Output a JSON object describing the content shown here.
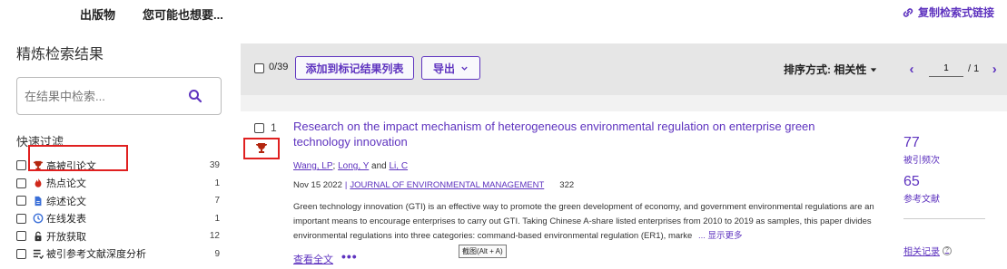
{
  "topnav": {
    "publications": "出版物",
    "you_may_like": "您可能也想要...",
    "copy_link": "复制检索式链接"
  },
  "refine": {
    "title": "精炼检索结果",
    "search_placeholder": "在结果中检索...",
    "quick_filter_title": "快速过滤",
    "filters": [
      {
        "label": "高被引论文",
        "count": "39",
        "icon": "trophy-icon"
      },
      {
        "label": "热点论文",
        "count": "1",
        "icon": "flame-icon"
      },
      {
        "label": "综述论文",
        "count": "7",
        "icon": "document-icon"
      },
      {
        "label": "在线发表",
        "count": "1",
        "icon": "clock-icon"
      },
      {
        "label": "开放获取",
        "count": "12",
        "icon": "lock-open-icon"
      },
      {
        "label": "被引参考文献深度分析",
        "count": "9",
        "icon": "list-analysis-icon"
      }
    ]
  },
  "toolbar": {
    "selected": "0/39",
    "add_to_marked": "添加到标记结果列表",
    "export": "导出",
    "sort_label": "排序方式: 相关性",
    "page_value": "1",
    "page_total": "/ 1"
  },
  "result": {
    "index": "1",
    "title": "Research on the impact mechanism of heterogeneous environmental regulation on enterprise green technology innovation",
    "authors": [
      "Wang, LP",
      "Long, Y",
      "Li, C"
    ],
    "author_sep_1": ";",
    "author_sep_2": "and",
    "date": "Nov 15 2022",
    "journal": "JOURNAL OF ENVIRONMENTAL MANAGEMENT",
    "volume": "322",
    "abstract": "Green technology innovation (GTI) is an effective way to promote the green development of economy, and government environmental regulations are an important means to encourage enterprises to carry out GTI. Taking Chinese A-share listed enterprises from 2010 to 2019 as samples, this paper divides environmental regulations into three categories: command-based environmental regulation (ER1), marke",
    "show_more": "... 显示更多",
    "full_text": "查看全文",
    "more_dots": "•••",
    "tooltip": "截图(Alt + A)",
    "citations": "77",
    "citations_label": "被引频次",
    "references": "65",
    "references_label": "参考文献",
    "related": "相关记录"
  },
  "colors": {
    "accent": "#5e33bf",
    "highlight": "#e02020",
    "trophy": "#b3260f"
  }
}
